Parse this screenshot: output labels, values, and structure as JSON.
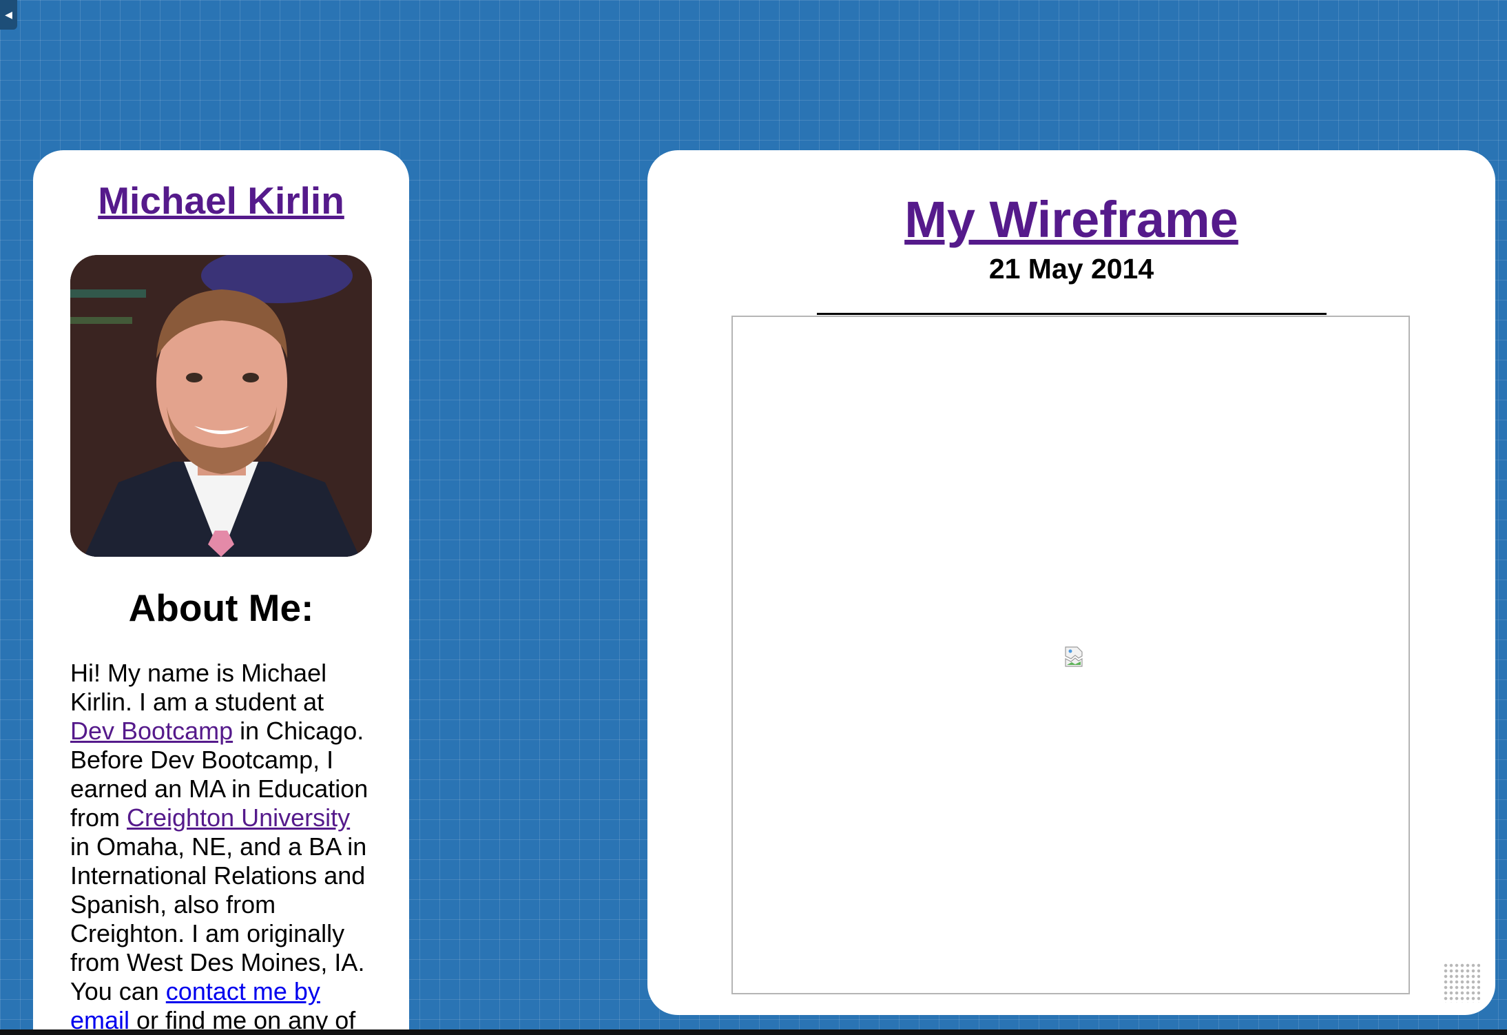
{
  "sidebar": {
    "name": "Michael Kirlin",
    "photo_alt": "photo",
    "about_heading": "About Me:",
    "bio": {
      "p1": "Hi! My name is Michael Kirlin. I am a student at ",
      "link1": "Dev Bootcamp",
      "p2": " in Chicago. Before Dev Bootcamp, I earned an MA in Education from ",
      "link2": "Creighton University",
      "p3": " in Omaha, NE, and a BA in International Relations and Spanish, also from Creighton. I am originally from West Des Moines, IA. You can ",
      "link3": "contact me by email",
      "p4": " or find me on any of"
    }
  },
  "main": {
    "title": "My Wireframe",
    "date": "21 May 2014"
  },
  "colors": {
    "background": "#2a74b4",
    "visited_link": "#551a8b",
    "unvisited_link": "#0000ee"
  },
  "icons": {
    "toggle": "triangle-left-icon",
    "broken_image": "broken-image-icon",
    "resize": "resize-grip-icon"
  }
}
